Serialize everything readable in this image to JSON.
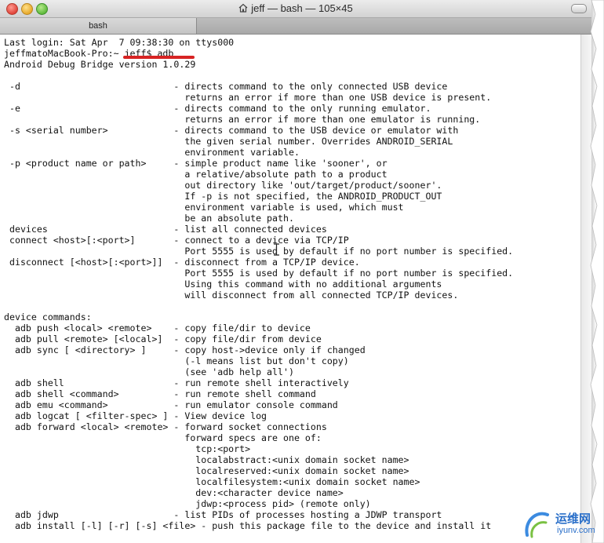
{
  "window": {
    "title": "jeff — bash — 105×45",
    "tab_label": "bash"
  },
  "terminal": {
    "lines": [
      "Last login: Sat Apr  7 09:38:30 on ttys000",
      "jeffmatoMacBook-Pro:~ jeff$ adb",
      "Android Debug Bridge version 1.0.29",
      "",
      " -d                            - directs command to the only connected USB device",
      "                                 returns an error if more than one USB device is present.",
      " -e                            - directs command to the only running emulator.",
      "                                 returns an error if more than one emulator is running.",
      " -s <serial number>            - directs command to the USB device or emulator with",
      "                                 the given serial number. Overrides ANDROID_SERIAL",
      "                                 environment variable.",
      " -p <product name or path>     - simple product name like 'sooner', or",
      "                                 a relative/absolute path to a product",
      "                                 out directory like 'out/target/product/sooner'.",
      "                                 If -p is not specified, the ANDROID_PRODUCT_OUT",
      "                                 environment variable is used, which must",
      "                                 be an absolute path.",
      " devices                       - list all connected devices",
      " connect <host>[:<port>]       - connect to a device via TCP/IP",
      "                                 Port 5555 is used by default if no port number is specified.",
      " disconnect [<host>[:<port>]]  - disconnect from a TCP/IP device.",
      "                                 Port 5555 is used by default if no port number is specified.",
      "                                 Using this command with no additional arguments",
      "                                 will disconnect from all connected TCP/IP devices.",
      "",
      "device commands:",
      "  adb push <local> <remote>    - copy file/dir to device",
      "  adb pull <remote> [<local>]  - copy file/dir from device",
      "  adb sync [ <directory> ]     - copy host->device only if changed",
      "                                 (-l means list but don't copy)",
      "                                 (see 'adb help all')",
      "  adb shell                    - run remote shell interactively",
      "  adb shell <command>          - run remote shell command",
      "  adb emu <command>            - run emulator console command",
      "  adb logcat [ <filter-spec> ] - View device log",
      "  adb forward <local> <remote> - forward socket connections",
      "                                 forward specs are one of:",
      "                                   tcp:<port>",
      "                                   localabstract:<unix domain socket name>",
      "                                   localreserved:<unix domain socket name>",
      "                                   localfilesystem:<unix domain socket name>",
      "                                   dev:<character device name>",
      "                                   jdwp:<process pid> (remote only)",
      "  adb jdwp                     - list PIDs of processes hosting a JDWP transport",
      "  adb install [-l] [-r] [-s] <file> - push this package file to the device and install it"
    ]
  },
  "watermark": {
    "line1": "运维网",
    "line2": "iyunv.com"
  },
  "colors": {
    "text": "#111111",
    "annotation_red": "#d72323",
    "watermark_blue": "#2a6fc9"
  }
}
